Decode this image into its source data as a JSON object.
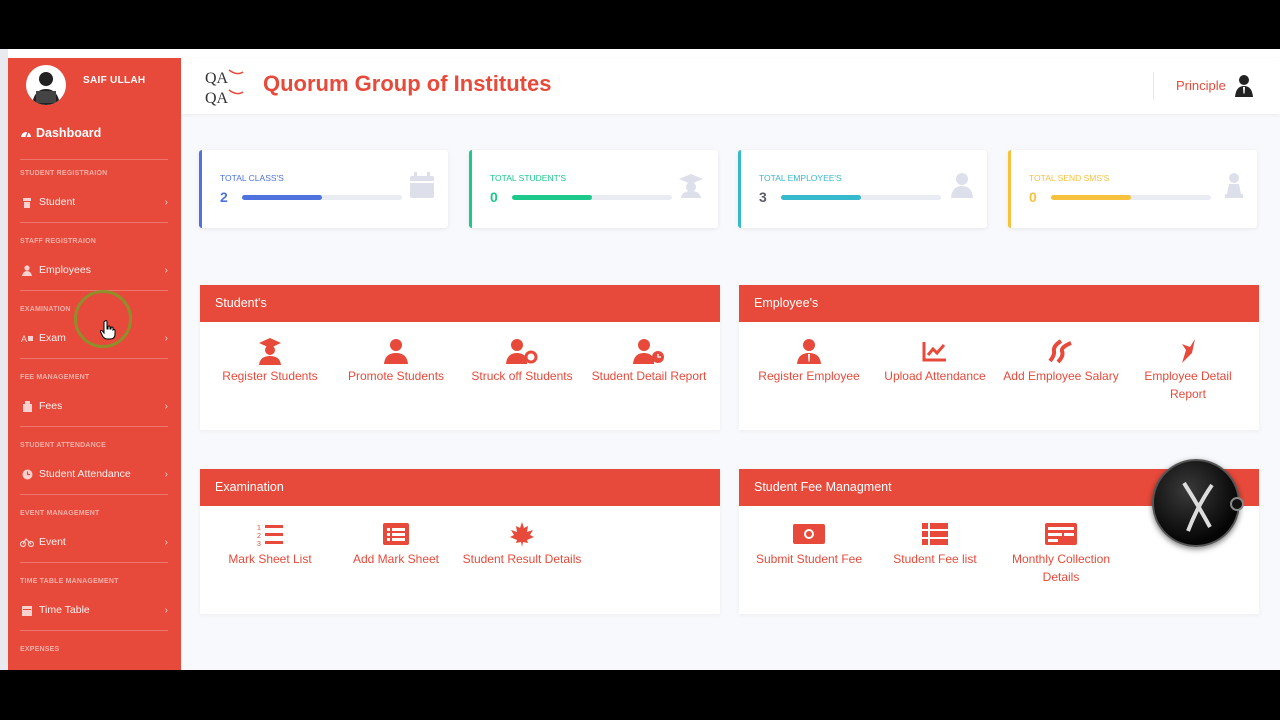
{
  "user": {
    "name": "SAIF ULLAH"
  },
  "sidebar": {
    "dashboard": "Dashboard",
    "sections": [
      {
        "title": "STUDENT REGISTRAION",
        "item": "Student"
      },
      {
        "title": "STAFF REGISTRAION",
        "item": "Employees"
      },
      {
        "title": "EXAMINATION",
        "item": "Exam"
      },
      {
        "title": "FEE MANAGEMENT",
        "item": "Fees"
      },
      {
        "title": "STUDENT ATTENDANCE",
        "item": "Student Attendance"
      },
      {
        "title": "EVENT MANAGEMENT",
        "item": "Event"
      },
      {
        "title": "TIME TABLE MANAGEMENT",
        "item": "Time Table"
      },
      {
        "title": "EXPENSES",
        "item": ""
      }
    ]
  },
  "header": {
    "brand": "Quorum Group of Institutes",
    "role": "Principle"
  },
  "stats": [
    {
      "label": "TOTAL CLASS'S",
      "value": "2",
      "progress": 0.5,
      "color": "#4e73df",
      "icon": "calendar-icon"
    },
    {
      "label": "TOTAL STUDENT'S",
      "value": "0",
      "progress": 0.5,
      "color": "#1cc88a",
      "icon": "graduation-cap-icon"
    },
    {
      "label": "TOTAL EMPLOYEE'S",
      "value": "3",
      "progress": 0.5,
      "color": "#36b9cc",
      "icon": "user-tie-icon"
    },
    {
      "label": "TOTAL SEND SMS'S",
      "value": "0",
      "progress": 0.5,
      "color": "#f6c23e",
      "icon": "chess-pawn-icon"
    }
  ],
  "panels": {
    "students": {
      "title": "Student's",
      "tiles": [
        "Register Students",
        "Promote Students",
        "Struck off Students",
        "Student Detail Report"
      ]
    },
    "employees": {
      "title": "Employee's",
      "tiles": [
        "Register Employee",
        "Upload Attendance",
        "Add Employee Salary",
        "Employee Detail Report"
      ]
    },
    "examination": {
      "title": "Examination",
      "tiles": [
        "Mark Sheet List",
        "Add Mark Sheet",
        "Student Result Details"
      ]
    },
    "fees": {
      "title": "Student Fee Managment",
      "tiles": [
        "Submit Student Fee",
        "Student Fee list",
        "Monthly Collection Details"
      ]
    }
  },
  "colors": {
    "accent": "#e74a3b",
    "background": "#f8f9fc"
  }
}
